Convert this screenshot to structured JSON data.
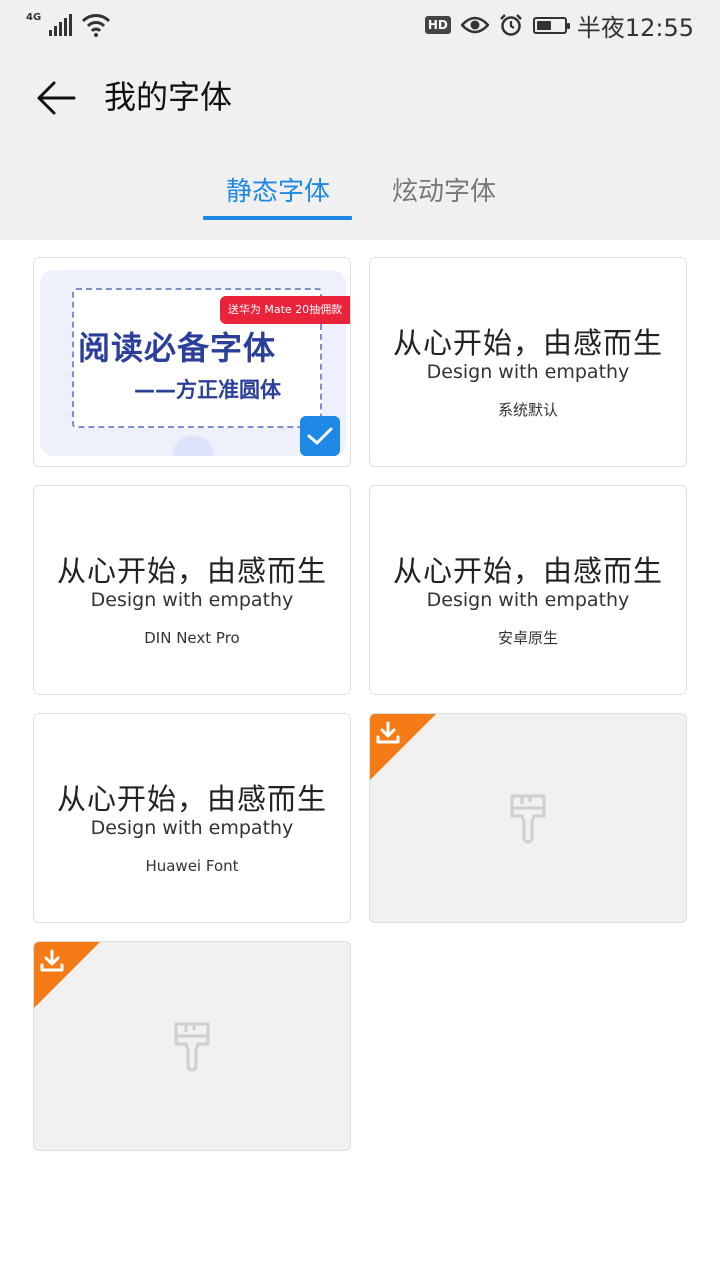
{
  "status_bar": {
    "network": "4G",
    "hd": "HD",
    "time": "半夜12:55",
    "battery_level": 0.55
  },
  "title_bar": {
    "title": "我的字体"
  },
  "tabs": [
    {
      "label": "静态字体",
      "active": true
    },
    {
      "label": "炫动字体",
      "active": false
    }
  ],
  "featured": {
    "title": "阅读必备字体",
    "subtitle": "——方正准圆体",
    "promo": "送华为 Mate 20抽佣款",
    "selected": true
  },
  "fonts": [
    {
      "sample_cn": "从心开始，由感而生",
      "sample_en": "Design with empathy",
      "name": "系统默认"
    },
    {
      "sample_cn": "从心开始，由感而生",
      "sample_en": "Design with empathy",
      "name": "DIN Next Pro"
    },
    {
      "sample_cn": "从心开始，由感而生",
      "sample_en": "Design with empathy",
      "name": "安卓原生"
    },
    {
      "sample_cn": "从心开始，由感而生",
      "sample_en": "Design with empathy",
      "name": "Huawei Font"
    }
  ],
  "colors": {
    "accent": "#1e88e5",
    "download": "#f47b16",
    "promo": "#e8233a",
    "header_bg": "#f0f0f0"
  },
  "icons": [
    "back-arrow-icon",
    "signal-icon",
    "wifi-icon",
    "eye-icon",
    "alarm-icon",
    "battery-icon",
    "check-icon",
    "download-icon",
    "brush-icon"
  ]
}
